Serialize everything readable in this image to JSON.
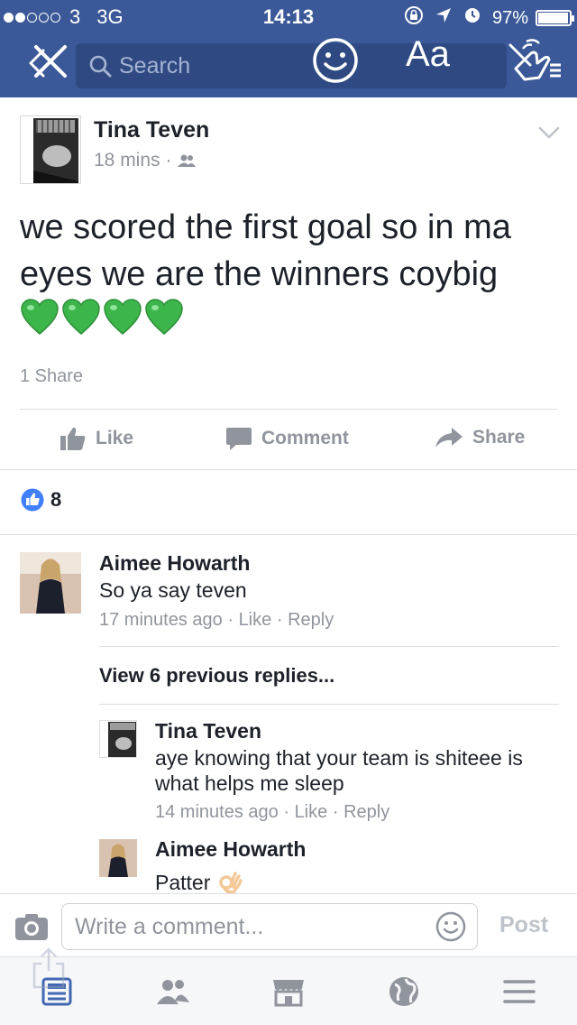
{
  "status_bar": {
    "carrier": "3",
    "network": "3G",
    "time": "14:13",
    "battery": "97%",
    "battery_level": 0.97,
    "signal_bars_filled": 2,
    "signal_bars_total": 5
  },
  "nav": {
    "search_placeholder": "Search",
    "text_size_label": "Aa",
    "close_icon": "close-icon",
    "emoji_icon": "smiley-icon",
    "touch_icon": "touch-gesture-icon"
  },
  "post": {
    "author": "Tina Teven",
    "time": "18 mins",
    "separator": "·",
    "audience_icon": "friends-icon",
    "text": "we scored the first goal so in ma eyes we are the winners coybig",
    "emoji": [
      "green-heart",
      "green-heart",
      "green-heart",
      "green-heart"
    ],
    "share_count": "1 Share",
    "actions": {
      "like": "Like",
      "comment": "Comment",
      "share": "Share"
    },
    "reaction_count": "8"
  },
  "comments": [
    {
      "author": "Aimee Howarth",
      "text": "So ya say teven",
      "time": "17 minutes ago",
      "like": "Like",
      "reply": "Reply"
    }
  ],
  "view_previous": "View 6 previous replies...",
  "replies": [
    {
      "author": "Tina Teven",
      "text": "aye knowing that your team is shiteee is what helps me sleep",
      "time": "14 minutes ago",
      "like": "Like",
      "reply": "Reply"
    },
    {
      "author": "Aimee Howarth",
      "text": "Patter",
      "emoji": "ok-hand"
    }
  ],
  "composer": {
    "placeholder": "Write a comment...",
    "post_label": "Post"
  },
  "colors": {
    "brand": "#3b5998",
    "meta": "#90949c",
    "heart": "#3cb54a",
    "like_blue": "#4080ff"
  },
  "tabs": [
    "news-feed-icon",
    "friends-icon",
    "marketplace-icon",
    "notifications-globe-icon",
    "menu-icon"
  ]
}
